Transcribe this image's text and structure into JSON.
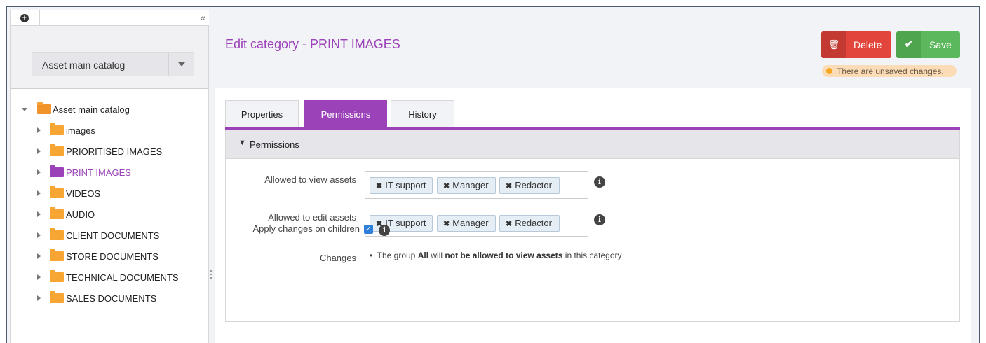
{
  "sidebar": {
    "add_icon": "plus-circle-icon",
    "collapse_glyph": "«",
    "catalog_select": {
      "value": "Asset main catalog"
    },
    "tree": {
      "root": {
        "label": "Asset main catalog"
      },
      "items": [
        {
          "label": "images"
        },
        {
          "label": "PRIORITISED IMAGES"
        },
        {
          "label": "PRINT IMAGES",
          "active": true
        },
        {
          "label": "VIDEOS"
        },
        {
          "label": "AUDIO"
        },
        {
          "label": "CLIENT DOCUMENTS"
        },
        {
          "label": "STORE DOCUMENTS"
        },
        {
          "label": "TECHNICAL DOCUMENTS"
        },
        {
          "label": "SALES DOCUMENTS"
        }
      ]
    }
  },
  "header": {
    "title": "Edit category - PRINT IMAGES",
    "delete_label": "Delete",
    "save_label": "Save",
    "unsaved_text": "There are unsaved changes."
  },
  "tabs": [
    {
      "label": "Properties"
    },
    {
      "label": "Permissions",
      "active": true
    },
    {
      "label": "History"
    }
  ],
  "permissions": {
    "section_title": "Permissions",
    "view": {
      "label": "Allowed to view assets",
      "tags": [
        "IT support",
        "Manager",
        "Redactor"
      ]
    },
    "edit": {
      "label": "Allowed to edit assets",
      "tags": [
        "IT support",
        "Manager",
        "Redactor"
      ]
    },
    "apply_children": {
      "label": "Apply changes on children",
      "checked": true
    },
    "changes": {
      "label": "Changes",
      "prefix": "The group",
      "group": "All",
      "will": "will",
      "action": "not be allowed to view assets",
      "suffix": "in this category"
    }
  },
  "colors": {
    "accent": "#9b42b8",
    "delete": "#e2453b",
    "save": "#5cb85c",
    "folder": "#f7a533"
  }
}
